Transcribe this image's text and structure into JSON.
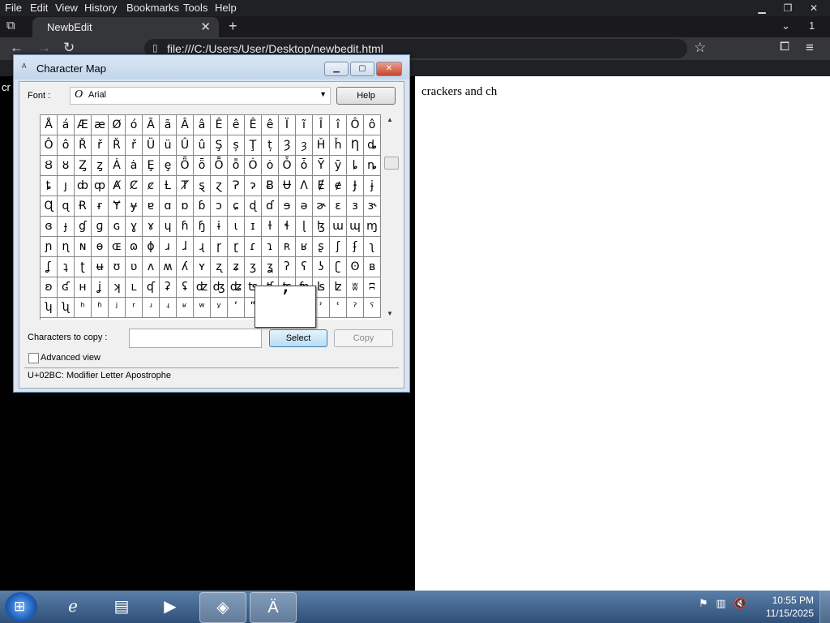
{
  "browser": {
    "menu": [
      "File",
      "Edit",
      "View",
      "History",
      "Bookmarks",
      "Tools",
      "Help"
    ],
    "tab_title": "NewbEdit",
    "tab_close": "✕",
    "url": "file:///C:/Users/User/Desktop/newbedit.html",
    "extensions_count": "1"
  },
  "page": {
    "text": "crackers and ch",
    "left_fragment": "cr"
  },
  "charmap": {
    "title": "Character Map",
    "font_label": "Font :",
    "font_icon": "O",
    "font_name": "Arial",
    "help_label": "Help",
    "grid": [
      [
        "Å",
        "á",
        "Æ",
        "æ",
        "Ø",
        "ó",
        "Ã",
        "ã",
        "Â",
        "â",
        "Ê",
        "ê",
        "Ê",
        "ê",
        "Ï",
        "ĩ",
        "Î",
        "î",
        "Ô",
        "ô"
      ],
      [
        "Ô",
        "ô",
        "Ř",
        "ř",
        "Ř",
        "ř",
        "Ü",
        "ü",
        "Û",
        "û",
        "Ş",
        "ș",
        "Ţ",
        "ț",
        "Ȝ",
        "ȝ",
        "Ȟ",
        "ȟ",
        "Ƞ",
        "ȡ"
      ],
      [
        "Ȣ",
        "ȣ",
        "Ȥ",
        "ȥ",
        "Ȧ",
        "ȧ",
        "Ȩ",
        "ȩ",
        "Ȫ",
        "ȫ",
        "Ȭ",
        "ȭ",
        "Ȯ",
        "ȯ",
        "Ȱ",
        "ȱ",
        "Ȳ",
        "ȳ",
        "ȴ",
        "ȵ"
      ],
      [
        "ȶ",
        "ȷ",
        "ȸ",
        "ȹ",
        "Ⱥ",
        "Ȼ",
        "ȼ",
        "Ƚ",
        "Ⱦ",
        "ȿ",
        "ɀ",
        "Ɂ",
        "ɂ",
        "Ƀ",
        "Ʉ",
        "Ʌ",
        "Ɇ",
        "ɇ",
        "Ɉ",
        "ɉ"
      ],
      [
        "Ɋ",
        "ɋ",
        "Ɍ",
        "ɍ",
        "Ɏ",
        "ɏ",
        "ɐ",
        "ɑ",
        "ɒ",
        "ɓ",
        "ɔ",
        "ɕ",
        "ɖ",
        "ɗ",
        "ɘ",
        "ə",
        "ɚ",
        "ɛ",
        "ɜ",
        "ɝ"
      ],
      [
        "ɞ",
        "ɟ",
        "ɠ",
        "ɡ",
        "ɢ",
        "ɣ",
        "ɤ",
        "ɥ",
        "ɦ",
        "ɧ",
        "ɨ",
        "ɩ",
        "ɪ",
        "ɫ",
        "ɬ",
        "ɭ",
        "ɮ",
        "ɯ",
        "ɰ",
        "ɱ"
      ],
      [
        "ɲ",
        "ɳ",
        "ɴ",
        "ɵ",
        "ɶ",
        "ɷ",
        "ɸ",
        "ɹ",
        "ɺ",
        "ɻ",
        "ɼ",
        "ɽ",
        "ɾ",
        "ɿ",
        "ʀ",
        "ʁ",
        "ʂ",
        "ʃ",
        "ʄ",
        "ʅ"
      ],
      [
        "ʆ",
        "ʇ",
        "ʈ",
        "ʉ",
        "ʊ",
        "ʋ",
        "ʌ",
        "ʍ",
        "ʎ",
        "ʏ",
        "ʐ",
        "ʑ",
        "ʒ",
        "ʓ",
        "ʔ",
        "ʕ",
        "ʖ",
        "ʗ",
        "ʘ",
        "ʙ"
      ],
      [
        "ʚ",
        "ʛ",
        "ʜ",
        "ʝ",
        "ʞ",
        "ʟ",
        "ʠ",
        "ʡ",
        "ʢ",
        "ʣ",
        "ʤ",
        "ʥ",
        "ʦ",
        "ʧ",
        "ʨ",
        "ʩ",
        "ʪ",
        "ʫ",
        "ʬ",
        "ʭ"
      ],
      [
        "ʮ",
        "ʯ",
        "ʰ",
        "ʱ",
        "ʲ",
        "ʳ",
        "ʴ",
        "ʵ",
        "ʶ",
        "ʷ",
        "ʸ",
        "ʹ",
        "ʺ",
        "ʻ",
        "ʼ",
        "ʽ",
        "ʾ",
        "ʿ",
        "ˀ",
        "ˁ"
      ]
    ],
    "magnified_char": "ʼ",
    "copy_label": "Characters to copy :",
    "copy_value": "",
    "select_label": "Select",
    "copy_button_label": "Copy",
    "advanced_label": "Advanced view",
    "status": "U+02BC: Modifier Letter Apostrophe"
  },
  "taskbar": {
    "time": "10:55 PM",
    "date": "11/15/2025"
  }
}
